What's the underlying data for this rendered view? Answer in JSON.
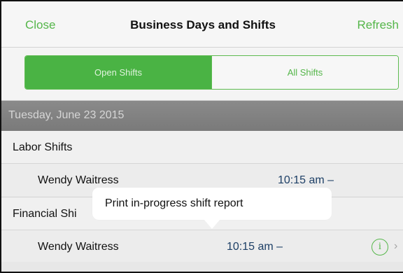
{
  "navbar": {
    "close_label": "Close",
    "title": "Business Days and Shifts",
    "refresh_label": "Refresh"
  },
  "segmented_control": {
    "open_label": "Open Shifts",
    "all_label": "All Shifts",
    "selected": "Open Shifts"
  },
  "date_header": "Tuesday, June 23 2015",
  "sections": {
    "labor": {
      "title": "Labor Shifts",
      "rows": [
        {
          "name": "Wendy Waitress",
          "time": "10:15 am  –"
        }
      ]
    },
    "financial": {
      "title": "Financial Shi",
      "rows": [
        {
          "name": "Wendy Waitress",
          "time": "10:15 am  –"
        }
      ]
    }
  },
  "tooltip": {
    "text": "Print in-progress shift report"
  },
  "icons": {
    "info": "info-circle-icon",
    "chevron": "chevron-right-icon"
  },
  "colors": {
    "accent_green": "#4ab344",
    "time_blue": "#1d3f66",
    "date_header_bg": "#808080"
  }
}
